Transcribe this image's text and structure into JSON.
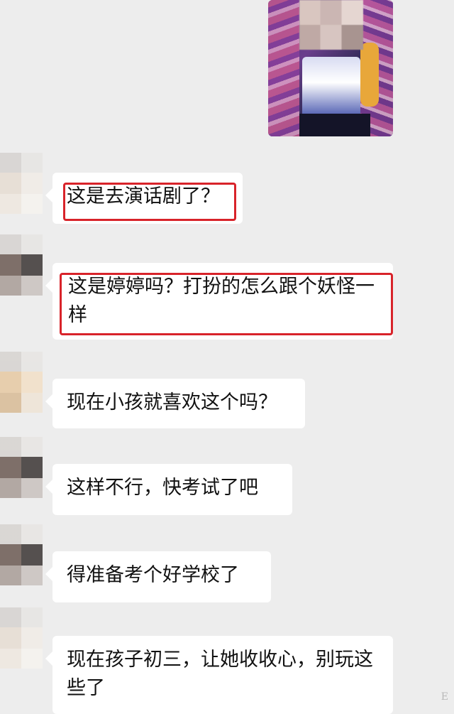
{
  "messages": [
    {
      "id": "m1",
      "text": "这是去演话剧了？",
      "highlighted": true
    },
    {
      "id": "m2",
      "text": "这是婷婷吗？打扮的怎么跟个妖怪一样",
      "highlighted": true
    },
    {
      "id": "m3",
      "text": "现在小孩就喜欢这个吗？",
      "highlighted": false
    },
    {
      "id": "m4",
      "text": "这样不行，快考试了吧",
      "highlighted": false
    },
    {
      "id": "m5",
      "text": "得准备考个好学校了",
      "highlighted": false
    },
    {
      "id": "m6",
      "text": "现在孩子初三，让她收收心，别玩这些了",
      "highlighted": false
    }
  ],
  "colors": {
    "background": "#ededed",
    "bubble": "#ffffff",
    "highlight_border": "#d8232a",
    "text": "#111111"
  },
  "watermark": "E"
}
